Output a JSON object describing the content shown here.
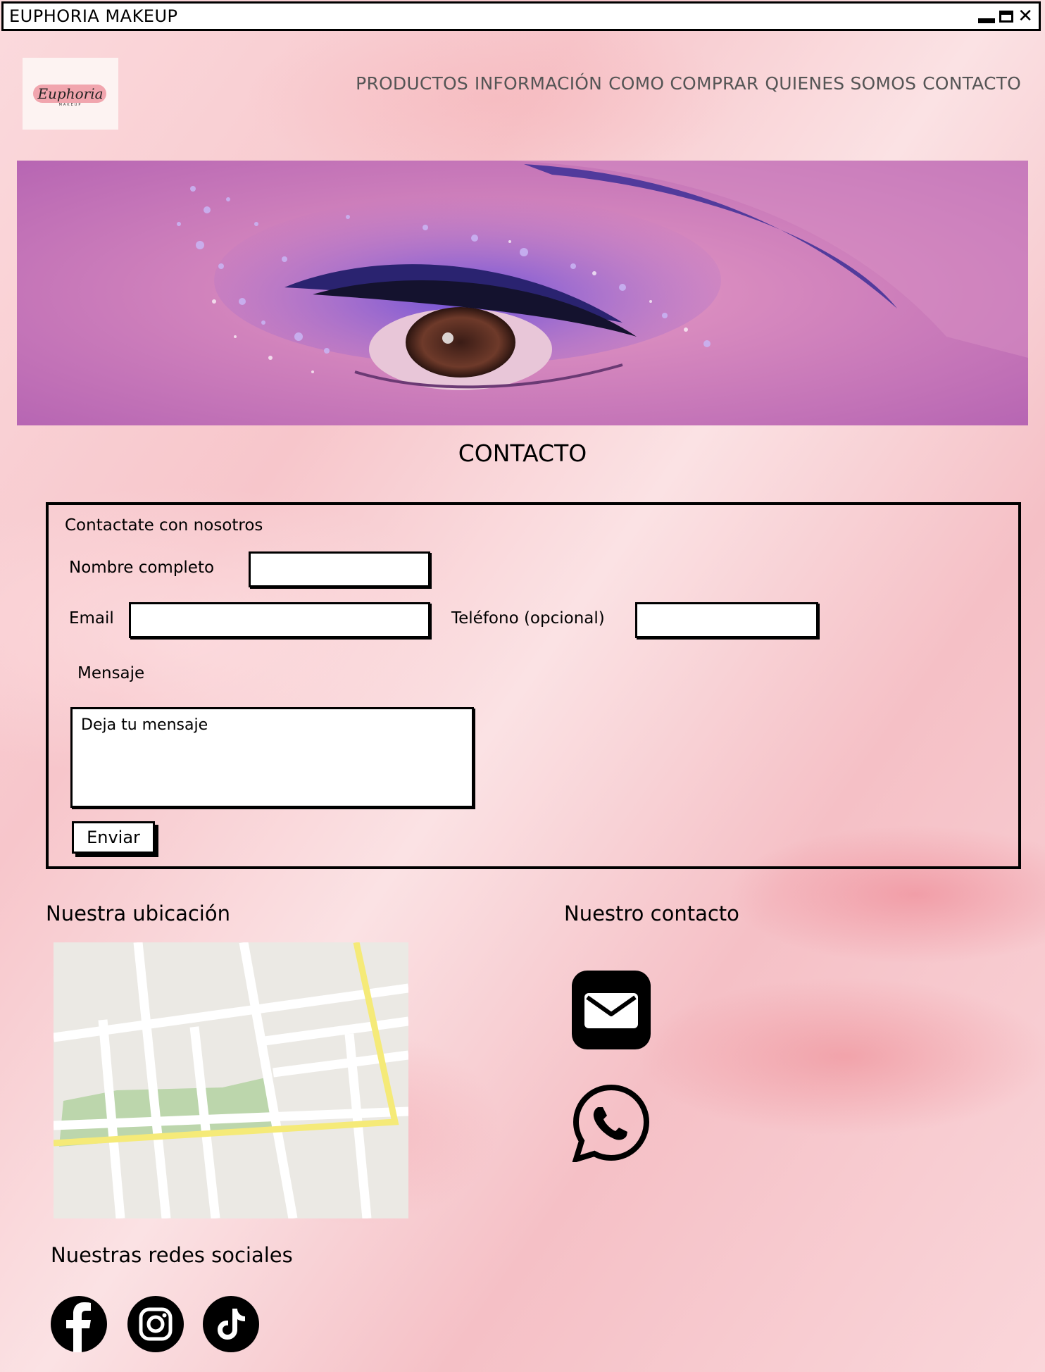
{
  "window": {
    "title": "EUPHORIA MAKEUP"
  },
  "logo": {
    "script": "Euphoria",
    "sub": "MAKEUP"
  },
  "nav": [
    {
      "label": "PRODUCTOS"
    },
    {
      "label": "INFORMACIÓN"
    },
    {
      "label": "COMO COMPRAR"
    },
    {
      "label": "QUIENES SOMOS"
    },
    {
      "label": "CONTACTO"
    }
  ],
  "page": {
    "title": "CONTACTO"
  },
  "form": {
    "heading": "Contactate con nosotros",
    "name_label": "Nombre completo",
    "name_value": "",
    "email_label": "Email",
    "email_value": "",
    "phone_label": "Teléfono (opcional)",
    "phone_value": "",
    "message_label": "Mensaje",
    "message_placeholder": "Deja tu mensaje",
    "submit_label": "Enviar"
  },
  "location": {
    "title": "Nuestra ubicación"
  },
  "contact": {
    "title": "Nuestro contacto",
    "icons": [
      "mail-icon",
      "whatsapp-icon"
    ]
  },
  "social": {
    "title": "Nuestras redes sociales",
    "icons": [
      "facebook-icon",
      "instagram-icon",
      "tiktok-icon"
    ]
  },
  "colors": {
    "background": "#f7c6cb",
    "text": "#000000",
    "nav_text": "#555555",
    "map_park": "#bcd6ac",
    "map_road_major": "#f5ea78"
  }
}
